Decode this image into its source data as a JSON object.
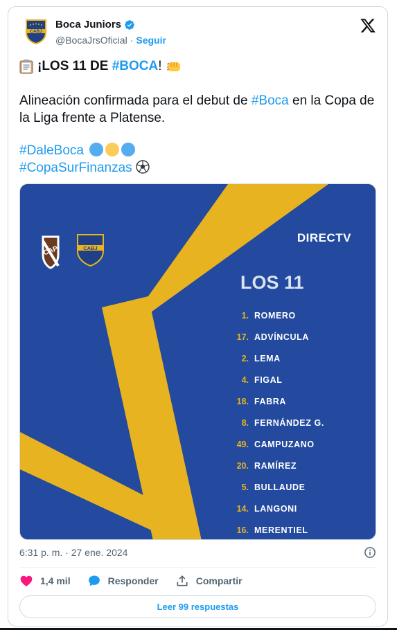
{
  "account": {
    "name": "Boca Juniors",
    "handle": "@BocaJrsOficial",
    "separator": "·",
    "follow_label": "Seguir",
    "avatar_text": "CABJ"
  },
  "tweet": {
    "line1_prefix": "¡",
    "line1_bold": "LOS 11 DE ",
    "line1_hashtag": "#BOCA",
    "line1_suffix": "!",
    "p2_start": "Alineación confirmada para el debut de ",
    "p2_hashtag": "#Boca",
    "p2_end": " en la Copa de la Liga frente a Platense.",
    "tag1": "#DaleBoca",
    "tag2": "#CopaSurFinanzas"
  },
  "media": {
    "rival_crest": "CAP",
    "home_crest": "CABJ",
    "sponsor": "DIRECTV",
    "heading": "LOS 11",
    "lineup": [
      {
        "num": "1.",
        "name": "ROMERO"
      },
      {
        "num": "17.",
        "name": "ADVÍNCULA"
      },
      {
        "num": "2.",
        "name": "LEMA"
      },
      {
        "num": "4.",
        "name": "FIGAL"
      },
      {
        "num": "18.",
        "name": "FABRA"
      },
      {
        "num": "8.",
        "name": "FERNÁNDEZ G."
      },
      {
        "num": "49.",
        "name": "CAMPUZANO"
      },
      {
        "num": "20.",
        "name": "RAMÍREZ"
      },
      {
        "num": "5.",
        "name": "BULLAUDE"
      },
      {
        "num": "14.",
        "name": "LANGONI"
      },
      {
        "num": "16.",
        "name": "MERENTIEL"
      }
    ]
  },
  "meta": {
    "timestamp": "6:31 p. m. · 27 ene. 2024"
  },
  "actions": {
    "likes": "1,4 mil",
    "reply_label": "Responder",
    "share_label": "Compartir",
    "read_replies": "Leer 99 respuestas"
  },
  "colors": {
    "blue": "#1d9bf0",
    "boca_blue": "#1f4596",
    "boca_gold": "#e8b320",
    "like_red": "#f91880"
  }
}
